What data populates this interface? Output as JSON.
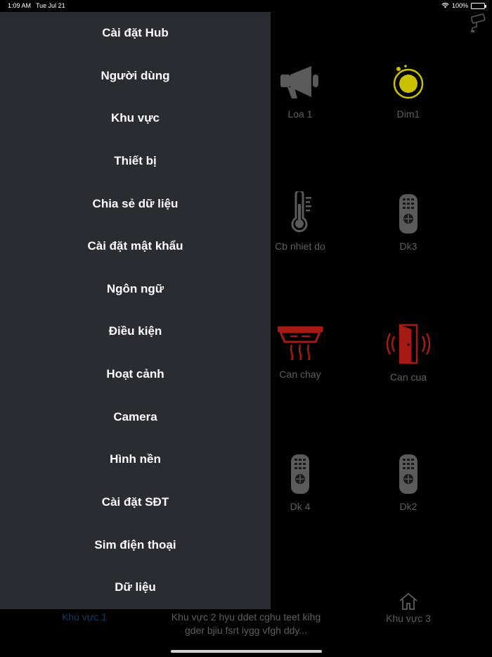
{
  "status_bar": {
    "time": "1:09 AM",
    "date": "Tue Jul 21",
    "battery": "100%"
  },
  "devices": [
    {
      "label": "Loa 1",
      "icon": "speaker-icon"
    },
    {
      "label": "Dim1",
      "icon": "dimmer-icon"
    },
    {
      "label": "Cb nhiet do",
      "icon": "thermometer-icon"
    },
    {
      "label": "Dk3",
      "icon": "remote-icon"
    },
    {
      "label": "Can chay",
      "icon": "fire-sensor-icon"
    },
    {
      "label": "Can cua",
      "icon": "door-sensor-icon"
    },
    {
      "label": "Dk 4",
      "icon": "remote-icon"
    },
    {
      "label": "Dk2",
      "icon": "remote-icon"
    }
  ],
  "tabs": [
    {
      "label": "Khu vực 1"
    },
    {
      "label": "Khu vực 2 hyu ddet cghu teet kihg gder bjiu fsrt iygg vfgh ddy..."
    },
    {
      "label": "Khu vực 3",
      "icon": "home-icon"
    }
  ],
  "menu": [
    "Cài đặt Hub",
    "Người dùng",
    "Khu vực",
    "Thiết bị",
    "Chia sẻ dữ liệu",
    "Cài đặt mật khẩu",
    "Ngôn ngữ",
    "Điều kiện",
    "Hoạt cảnh",
    "Camera",
    "Hình nền",
    "Cài đặt SĐT",
    "Sim điện thoại",
    "Dữ liệu"
  ],
  "colors": {
    "drawer": "#2b2c31",
    "dimmer": "#c9c000",
    "alarm_red": "#a51a14",
    "active_tab": "#0a3e66",
    "muted": "#5e5e5e"
  }
}
